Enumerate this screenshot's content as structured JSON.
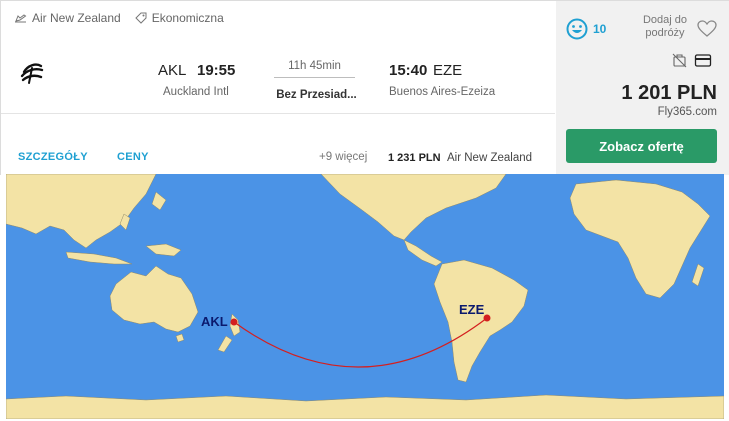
{
  "flight": {
    "airline": "Air New Zealand",
    "cabin": "Ekonomiczna",
    "departure": {
      "code": "AKL",
      "time": "19:55",
      "airport": "Auckland Intl"
    },
    "duration": "11h 45min",
    "stops": "Bez Przesiad...",
    "arrival": {
      "time": "15:40",
      "code": "EZE",
      "airport": "Buenos Aires-Ezeiza"
    }
  },
  "tabs": {
    "details": "SZCZEGÓŁY",
    "prices": "CENY"
  },
  "alternatives": {
    "more": "+9 więcej",
    "price": "1 231 PLN",
    "airline": "Air New Zealand"
  },
  "offer": {
    "score": "10",
    "favorite_label": "Dodaj do podróży",
    "price": "1 201 PLN",
    "provider": "Fly365.com",
    "cta": "Zobacz ofertę"
  },
  "map": {
    "origin_label": "AKL",
    "destination_label": "EZE"
  },
  "colors": {
    "accent": "#1fa0d2",
    "cta": "#2a9a67",
    "ocean": "#4b93e6",
    "land": "#f3e3a5",
    "route": "#d41f1f"
  }
}
